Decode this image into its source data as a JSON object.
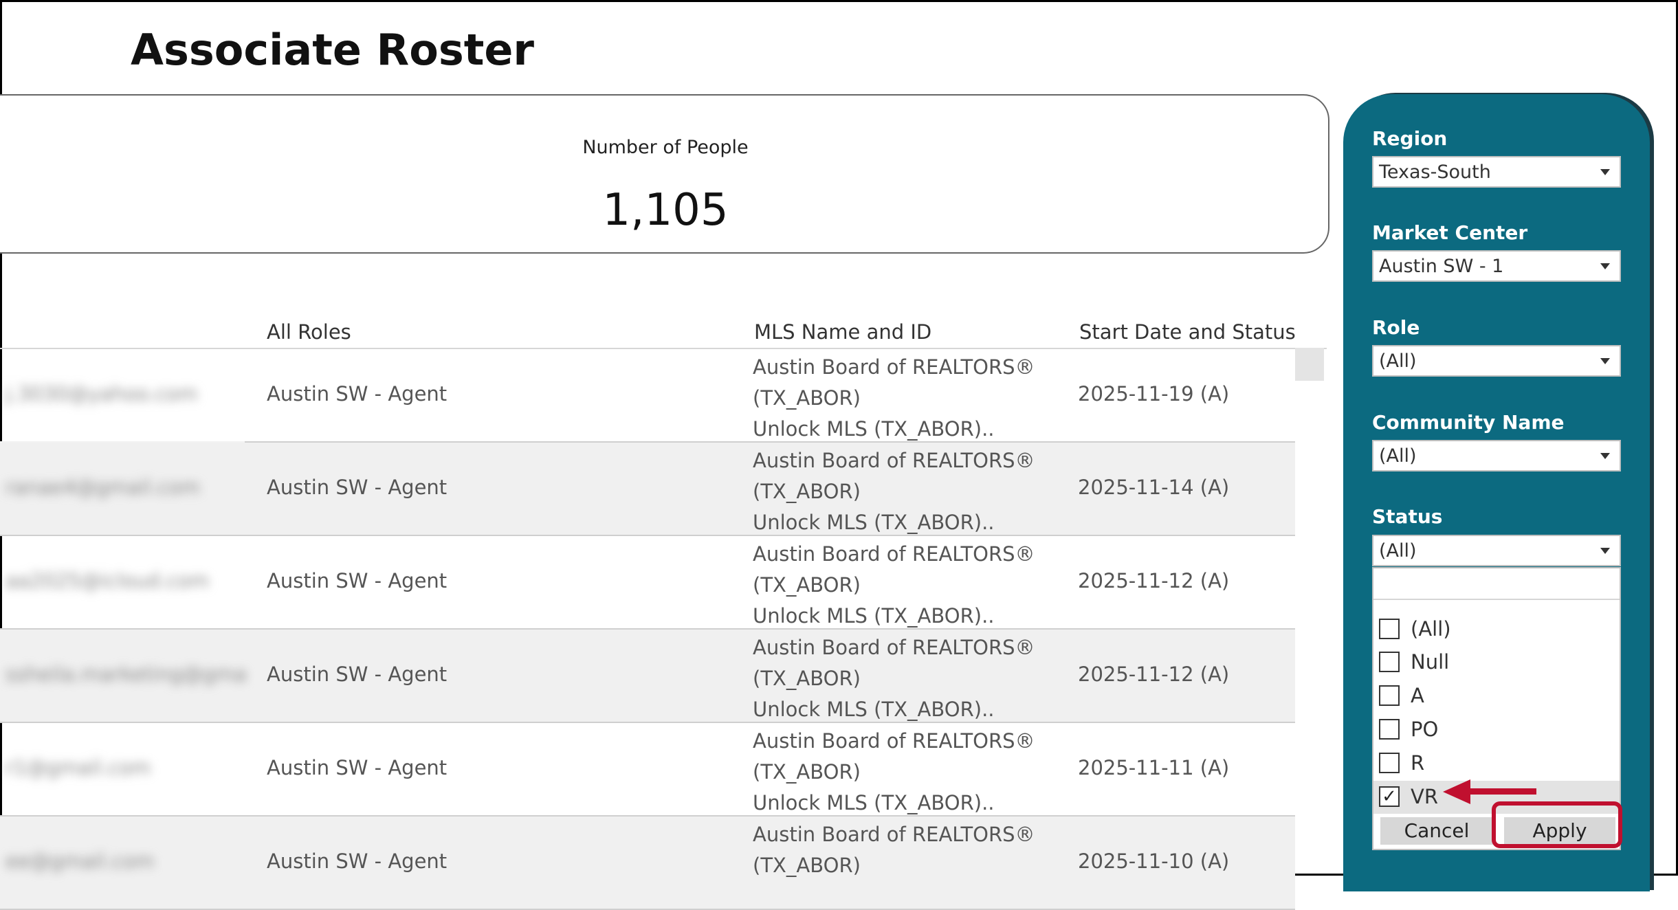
{
  "page": {
    "title": "Associate Roster"
  },
  "kpi": {
    "label": "Number of People",
    "value": "1,105"
  },
  "table": {
    "columns": [
      "",
      "All Roles",
      "MLS Name and ID",
      "Start Date and Status"
    ],
    "rows": [
      {
        "email": "j.3030@yahoo.com",
        "role": "Austin SW - Agent",
        "mls_line1": "Austin Board of REALTORS®",
        "mls_line2": "(TX_ABOR)",
        "mls_line3": "Unlock MLS (TX_ABOR)..",
        "start": "2025-11-19 (A)"
      },
      {
        "email": "ranae4@gmail.com",
        "role": "Austin SW - Agent",
        "mls_line1": "Austin Board of REALTORS®",
        "mls_line2": "(TX_ABOR)",
        "mls_line3": "Unlock MLS (TX_ABOR)..",
        "start": "2025-11-14 (A)"
      },
      {
        "email": "aa2025@icloud.com",
        "role": "Austin SW - Agent",
        "mls_line1": "Austin Board of REALTORS®",
        "mls_line2": "(TX_ABOR)",
        "mls_line3": "Unlock MLS (TX_ABOR)..",
        "start": "2025-11-12 (A)"
      },
      {
        "email": "ssheila.marketing@gmail.c..",
        "role": "Austin SW - Agent",
        "mls_line1": "Austin Board of REALTORS®",
        "mls_line2": "(TX_ABOR)",
        "mls_line3": "Unlock MLS (TX_ABOR)..",
        "start": "2025-11-12 (A)"
      },
      {
        "email": "r1@gmail.com",
        "role": "Austin SW - Agent",
        "mls_line1": "Austin Board of REALTORS®",
        "mls_line2": "(TX_ABOR)",
        "mls_line3": "Unlock MLS (TX_ABOR)..",
        "start": "2025-11-11 (A)"
      },
      {
        "email": "ee@gmail.com",
        "role": "Austin SW - Agent",
        "mls_line1": "Austin Board of REALTORS®",
        "mls_line2": "(TX_ABOR)",
        "mls_line3": "",
        "start": "2025-11-10 (A)"
      }
    ]
  },
  "filters": {
    "region": {
      "label": "Region",
      "value": "Texas-South"
    },
    "market_center": {
      "label": "Market Center",
      "value": "Austin SW - 1"
    },
    "role": {
      "label": "Role",
      "value": "(All)"
    },
    "community": {
      "label": "Community Name",
      "value": "(All)"
    },
    "status": {
      "label": "Status",
      "value": "(All)",
      "options": [
        {
          "label": "(All)",
          "checked": false
        },
        {
          "label": "Null",
          "checked": false
        },
        {
          "label": "A",
          "checked": false
        },
        {
          "label": "PO",
          "checked": false
        },
        {
          "label": "R",
          "checked": false
        },
        {
          "label": "VR",
          "checked": true
        }
      ],
      "check_mark": "✓",
      "cancel_label": "Cancel",
      "apply_label": "Apply"
    }
  },
  "colors": {
    "panel": "#0c6a80",
    "highlight": "#c0102f"
  }
}
